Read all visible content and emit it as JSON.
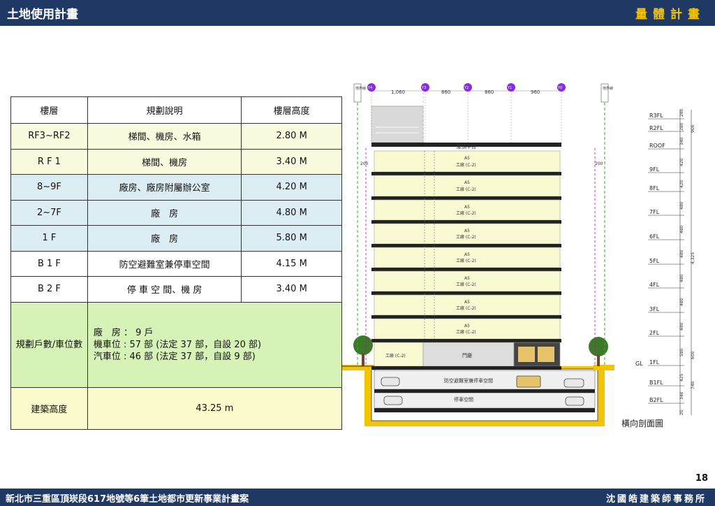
{
  "header": {
    "title": "土地使用計畫",
    "section": "量體計畫"
  },
  "footer": {
    "project": "新北市三重區頂崁段617地號等6筆土地都市更新事業計畫案",
    "firm": "沈國皓建築師事務所",
    "page": "18"
  },
  "table": {
    "headers": [
      "樓層",
      "規劃說明",
      "樓層高度"
    ],
    "rows": [
      {
        "floor": "RF3~RF2",
        "desc": "梯間、機房、水箱",
        "height": "2.80 M"
      },
      {
        "floor": "R F 1",
        "desc": "梯間、機房",
        "height": "3.40 M"
      },
      {
        "floor": "8~9F",
        "desc": "廠房、廠房附屬辦公室",
        "height": "4.20 M"
      },
      {
        "floor": "2~7F",
        "desc": "廠　房",
        "height": "4.80 M"
      },
      {
        "floor": "1 F",
        "desc": "廠　房",
        "height": "5.80 M"
      },
      {
        "floor": "B 1 F",
        "desc": "防空避難室兼停車空間",
        "height": "4.15 M"
      },
      {
        "floor": "B 2 F",
        "desc": "停 車 空 間、機 房",
        "height": "3.40 M"
      }
    ],
    "units_label": "規劃戶數/車位數",
    "units_lines": [
      "廠　房 ：  9 戶",
      "機車位 : 57 部 (法定 37 部，自設 20 部)",
      "汽車位 : 46 部 (法定 37 部，自設  9 部)"
    ],
    "height_label": "建築高度",
    "height_value": "43.25 m"
  },
  "drawing": {
    "caption": "橫向剖面圖",
    "grid_labels": [
      "Y4",
      "Y3",
      "Y2",
      "Y1",
      "Y0"
    ],
    "grid_dims": [
      "1,060",
      "860",
      "860",
      "960"
    ],
    "boundary_label": "地界線",
    "roof_label": "屋頂平台",
    "unit_label": "A5",
    "unit_use": "工廠 (C-2)",
    "ground_unit": "工廠 (C-2)",
    "lobby": "門廳",
    "b1_label": "防空避難室兼停車空間",
    "b2_label": "停車空間",
    "setback": "200",
    "floor_labels": [
      "R3FL",
      "R2FL",
      "ROOF",
      "9FL",
      "8FL",
      "7FL",
      "6FL",
      "5FL",
      "4FL",
      "3FL",
      "2FL",
      "1FL",
      "GL",
      "B1FL",
      "B2FL"
    ],
    "floor_dims": [
      "280",
      "280",
      "340",
      "420",
      "420",
      "480",
      "480",
      "480",
      "480",
      "480",
      "480",
      "580",
      "425",
      "340",
      "20"
    ],
    "total_dims": [
      "900",
      "4,325",
      "600",
      "740"
    ]
  }
}
